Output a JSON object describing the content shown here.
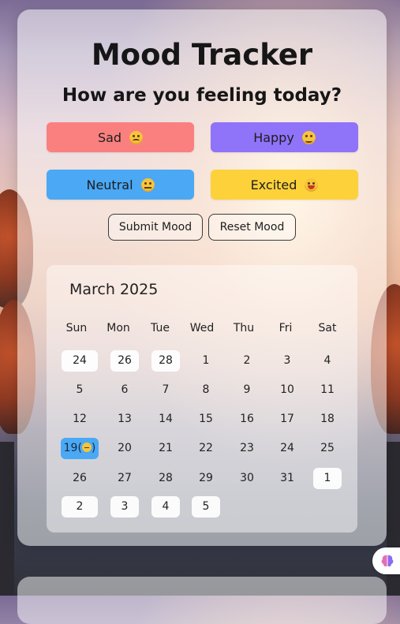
{
  "header": {
    "title": "Mood Tracker",
    "subtitle": "How are you feeling today?"
  },
  "moods": [
    {
      "label": "Sad",
      "icon": "sad-face-icon",
      "color": "#fa8080"
    },
    {
      "label": "Happy",
      "icon": "smiling-face-icon",
      "color": "#8f73f8"
    },
    {
      "label": "Neutral",
      "icon": "neutral-face-icon",
      "color": "#4aa8f5"
    },
    {
      "label": "Excited",
      "icon": "tongue-face-icon",
      "color": "#fdd13a"
    }
  ],
  "actions": {
    "submit_label": "Submit Mood",
    "reset_label": "Reset Mood"
  },
  "calendar": {
    "month_label": "March 2025",
    "weekdays": [
      "Sun",
      "Mon",
      "Tue",
      "Wed",
      "Thu",
      "Fri",
      "Sat"
    ],
    "weeks": [
      [
        "24",
        "26",
        "28",
        "1",
        "2",
        "3",
        "4"
      ],
      [
        "5",
        "6",
        "7",
        "8",
        "9",
        "10",
        "11"
      ],
      [
        "12",
        "13",
        "14",
        "15",
        "16",
        "17",
        "18"
      ],
      [
        "19(",
        "20",
        "21",
        "22",
        "23",
        "24",
        "25"
      ],
      [
        "26",
        "27",
        "28",
        "29",
        "30",
        "31",
        "1"
      ],
      [
        "2",
        "3",
        "4",
        "5"
      ]
    ],
    "selected_day_suffix": ")",
    "selected_day_icon": "neutral-face-icon"
  },
  "assistant": {
    "icon": "brain-icon"
  }
}
